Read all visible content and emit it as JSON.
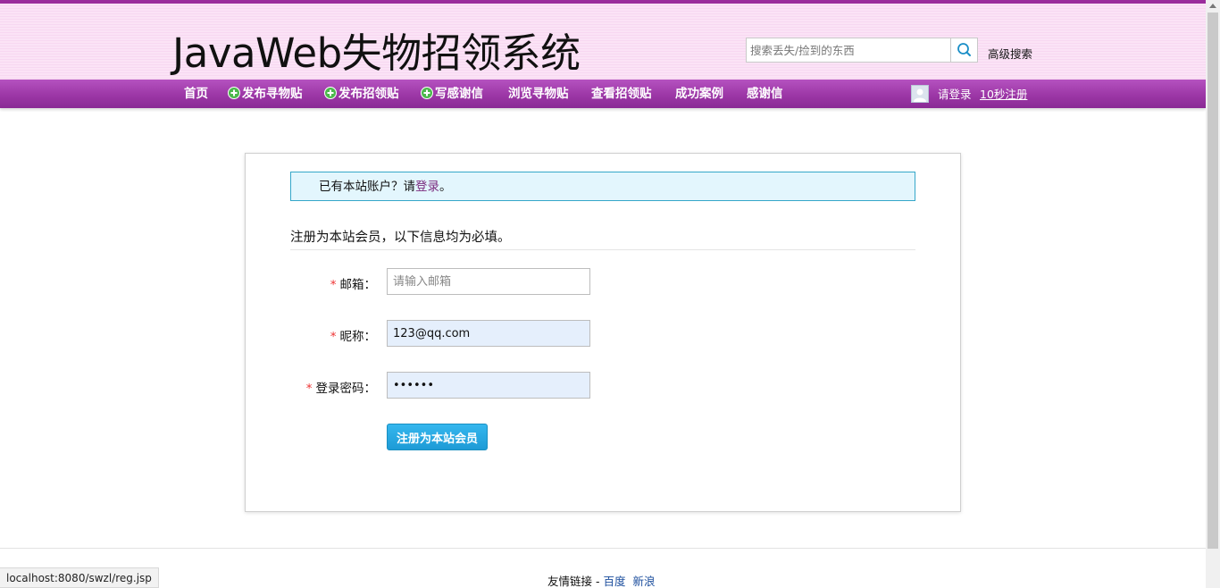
{
  "header": {
    "logo_text": "JavaWeb失物招领系统",
    "search_placeholder": "搜索丢失/捡到的东西",
    "advanced_search": "高级搜索"
  },
  "nav": {
    "items": [
      {
        "label": "首页",
        "icon": ""
      },
      {
        "label": "发布寻物贴",
        "icon": "plus-circle-icon"
      },
      {
        "label": "发布招领贴",
        "icon": "plus-circle-icon"
      },
      {
        "label": "写感谢信",
        "icon": "plus-circle-icon"
      },
      {
        "label": "浏览寻物贴",
        "icon": ""
      },
      {
        "label": "查看招领贴",
        "icon": ""
      },
      {
        "label": "成功案例",
        "icon": ""
      },
      {
        "label": "感谢信",
        "icon": ""
      }
    ],
    "login_label": "请登录",
    "register_label": "10秒注册"
  },
  "notice": {
    "prefix": "已有本站账户？请",
    "link": "登录",
    "suffix": "。"
  },
  "form": {
    "title": "注册为本站会员，以下信息均为必填。",
    "required_mark": "*",
    "fields": [
      {
        "label": "邮箱：",
        "placeholder": "请输入邮箱",
        "value": ""
      },
      {
        "label": "昵称：",
        "placeholder": "",
        "value": "123@qq.com"
      },
      {
        "label": "登录密码：",
        "placeholder": "",
        "value": "••••••"
      }
    ],
    "submit_label": "注册为本站会员"
  },
  "footer": {
    "prefix": "友情链接 - ",
    "links": [
      "百度",
      "新浪"
    ]
  },
  "status_bar": {
    "url": "localhost:8080/swzl/reg.jsp"
  },
  "colors": {
    "nav_purple": "#9c37a6",
    "header_pink": "#fbe3f6",
    "notice_border": "#35a7c9",
    "button_blue": "#1d9bd6",
    "required_red": "#ee3333"
  }
}
